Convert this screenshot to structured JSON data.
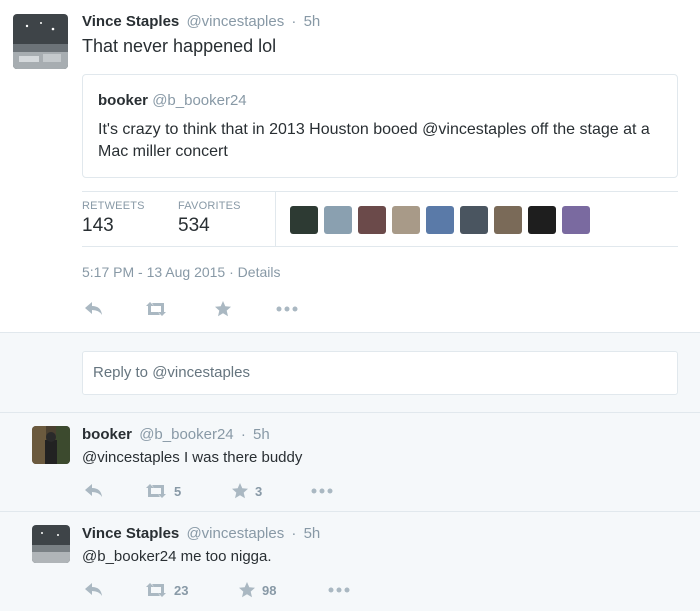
{
  "main_tweet": {
    "name": "Vince Staples",
    "handle": "@vincestaples",
    "dot": "·",
    "time": "5h",
    "text": "That never happened lol",
    "quote": {
      "name": "booker",
      "handle": "@b_booker24",
      "text": "It's crazy to think that in 2013 Houston booed @vincestaples off the stage at a Mac miller concert"
    },
    "stats": {
      "retweets_label": "RETWEETS",
      "retweets": "143",
      "favorites_label": "FAVORITES",
      "favorites": "534"
    },
    "favoriter_avatar_colors": [
      "#2d3a33",
      "#8aa0b0",
      "#6b4a4a",
      "#a89a88",
      "#5a7aa8",
      "#4a5560",
      "#7a6a58",
      "#1e1e1e",
      "#7a6aa0"
    ],
    "timestamp": "5:17 PM - 13 Aug 2015",
    "details_sep": "·",
    "details": "Details",
    "actions": {
      "reply_icon": "reply-icon",
      "retweet_icon": "retweet-icon",
      "favorite_icon": "star-icon",
      "more_icon": "more-icon"
    }
  },
  "reply_box": {
    "placeholder": "Reply to @vincestaples"
  },
  "replies": [
    {
      "name": "booker",
      "handle": "@b_booker24",
      "dot": "·",
      "time": "5h",
      "text": "@vincestaples I was there buddy",
      "retweets": "5",
      "favorites": "3"
    },
    {
      "name": "Vince Staples",
      "handle": "@vincestaples",
      "dot": "·",
      "time": "5h",
      "text": "@b_booker24 me too nigga.",
      "retweets": "23",
      "favorites": "98"
    }
  ],
  "colors": {
    "text": "#292f33",
    "muted": "#8899a6",
    "icon": "#aab8c2",
    "border": "#e1e8ed",
    "background": "#f5f8fa"
  }
}
